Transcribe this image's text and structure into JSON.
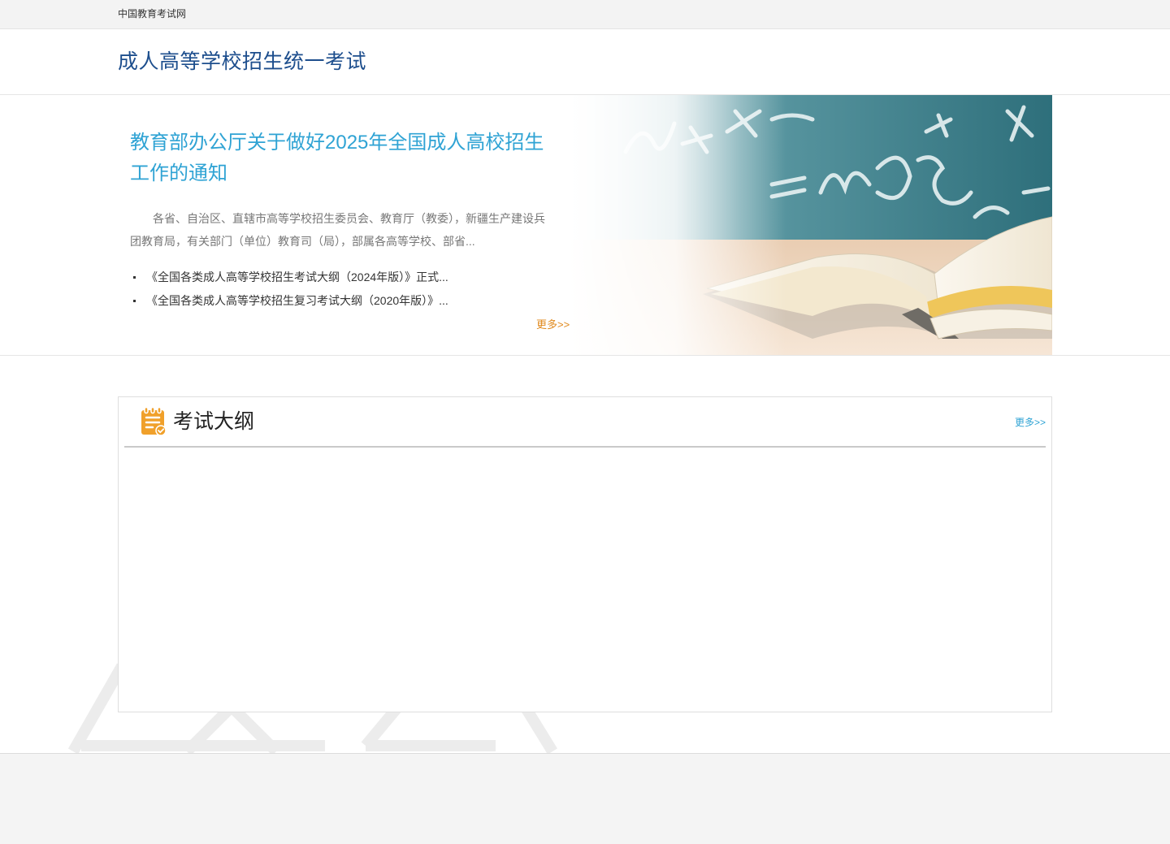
{
  "topbar": {
    "site_link": "中国教育考试网"
  },
  "header": {
    "title": "成人高等学校招生统一考试"
  },
  "banner": {
    "headline": "教育部办公厅关于做好2025年全国成人高校招生工作的通知",
    "summary": "各省、自治区、直辖市高等学校招生委员会、教育厅（教委），新疆生产建设兵团教育局，有关部门（单位）教育司（局），部属各高等学校、部省...",
    "items": [
      {
        "label": "《全国各类成人高等学校招生考试大纲（2024年版）》正式..."
      },
      {
        "label": "《全国各类成人高等学校招生复习考试大纲（2020年版）》..."
      }
    ],
    "more_label": "更多>>"
  },
  "syllabus": {
    "title": "考试大纲",
    "more_label": "更多>>",
    "icon": "notepad-check-icon"
  },
  "colors": {
    "title_blue": "#1d4e8d",
    "headline_blue": "#2fa3d4",
    "more_orange": "#e08a1e",
    "icon_orange": "#f0a02a"
  }
}
